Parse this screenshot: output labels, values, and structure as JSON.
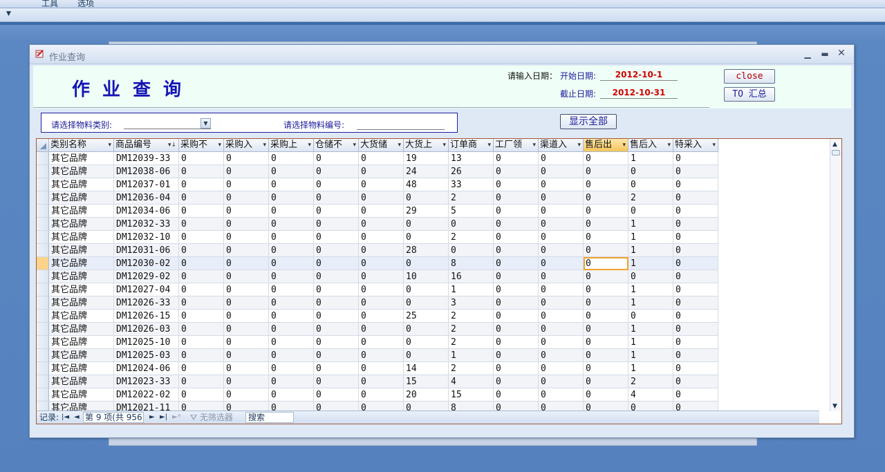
{
  "app": {
    "menu": [
      "工具",
      "选项"
    ]
  },
  "window": {
    "title": "作业查询"
  },
  "header": {
    "title": "作业查询",
    "date_prompt": "请输入日期：",
    "start_label": "开始日期:",
    "start_date": "2012-10-1",
    "end_label": "截止日期:",
    "end_date": "2012-10-31",
    "close_label": "close",
    "summary_label": "TO 汇总"
  },
  "filter": {
    "category_label": "请选择物料类别:",
    "category_value": "",
    "code_label": "请选择物料编号:",
    "code_value": "",
    "show_all_label": "显示全部"
  },
  "table": {
    "columns": [
      "类别名称",
      "商品编号",
      "采购不",
      "采购入",
      "采购上",
      "仓储不",
      "大货储",
      "大货上",
      "订单商",
      "工厂领",
      "渠道入",
      "售后出",
      "售后入",
      "特采入"
    ],
    "active_column_index": 11,
    "current_row_index": 8,
    "rows": [
      [
        "其它品牌",
        "DM12039-33",
        "0",
        "0",
        "0",
        "0",
        "0",
        "19",
        "13",
        "0",
        "0",
        "0",
        "1",
        "0"
      ],
      [
        "其它品牌",
        "DM12038-06",
        "0",
        "0",
        "0",
        "0",
        "0",
        "24",
        "26",
        "0",
        "0",
        "0",
        "0",
        "0"
      ],
      [
        "其它品牌",
        "DM12037-01",
        "0",
        "0",
        "0",
        "0",
        "0",
        "48",
        "33",
        "0",
        "0",
        "0",
        "0",
        "0"
      ],
      [
        "其它品牌",
        "DM12036-04",
        "0",
        "0",
        "0",
        "0",
        "0",
        "0",
        "2",
        "0",
        "0",
        "0",
        "2",
        "0"
      ],
      [
        "其它品牌",
        "DM12034-06",
        "0",
        "0",
        "0",
        "0",
        "0",
        "29",
        "5",
        "0",
        "0",
        "0",
        "0",
        "0"
      ],
      [
        "其它品牌",
        "DM12032-33",
        "0",
        "0",
        "0",
        "0",
        "0",
        "0",
        "0",
        "0",
        "0",
        "0",
        "1",
        "0"
      ],
      [
        "其它品牌",
        "DM12032-10",
        "0",
        "0",
        "0",
        "0",
        "0",
        "0",
        "2",
        "0",
        "0",
        "0",
        "1",
        "0"
      ],
      [
        "其它品牌",
        "DM12031-06",
        "0",
        "0",
        "0",
        "0",
        "0",
        "28",
        "0",
        "0",
        "0",
        "0",
        "1",
        "0"
      ],
      [
        "其它品牌",
        "DM12030-02",
        "0",
        "0",
        "0",
        "0",
        "0",
        "0",
        "8",
        "0",
        "0",
        "0",
        "1",
        "0"
      ],
      [
        "其它品牌",
        "DM12029-02",
        "0",
        "0",
        "0",
        "0",
        "0",
        "10",
        "16",
        "0",
        "0",
        "0",
        "0",
        "0"
      ],
      [
        "其它品牌",
        "DM12027-04",
        "0",
        "0",
        "0",
        "0",
        "0",
        "0",
        "1",
        "0",
        "0",
        "0",
        "1",
        "0"
      ],
      [
        "其它品牌",
        "DM12026-33",
        "0",
        "0",
        "0",
        "0",
        "0",
        "0",
        "3",
        "0",
        "0",
        "0",
        "1",
        "0"
      ],
      [
        "其它品牌",
        "DM12026-15",
        "0",
        "0",
        "0",
        "0",
        "0",
        "25",
        "2",
        "0",
        "0",
        "0",
        "0",
        "0"
      ],
      [
        "其它品牌",
        "DM12026-03",
        "0",
        "0",
        "0",
        "0",
        "0",
        "0",
        "2",
        "0",
        "0",
        "0",
        "1",
        "0"
      ],
      [
        "其它品牌",
        "DM12025-10",
        "0",
        "0",
        "0",
        "0",
        "0",
        "0",
        "2",
        "0",
        "0",
        "0",
        "1",
        "0"
      ],
      [
        "其它品牌",
        "DM12025-03",
        "0",
        "0",
        "0",
        "0",
        "0",
        "0",
        "1",
        "0",
        "0",
        "0",
        "1",
        "0"
      ],
      [
        "其它品牌",
        "DM12024-06",
        "0",
        "0",
        "0",
        "0",
        "0",
        "14",
        "2",
        "0",
        "0",
        "0",
        "1",
        "0"
      ],
      [
        "其它品牌",
        "DM12023-33",
        "0",
        "0",
        "0",
        "0",
        "0",
        "15",
        "4",
        "0",
        "0",
        "0",
        "2",
        "0"
      ],
      [
        "其它品牌",
        "DM12022-02",
        "0",
        "0",
        "0",
        "0",
        "0",
        "20",
        "15",
        "0",
        "0",
        "0",
        "4",
        "0"
      ],
      [
        "其它品牌",
        "DM12021-11",
        "0",
        "0",
        "0",
        "0",
        "0",
        "0",
        "8",
        "0",
        "0",
        "0",
        "0",
        "0"
      ]
    ]
  },
  "navigation": {
    "record_label": "记录:",
    "record_position": "第 9 项(共 956 项",
    "filter_label": "无筛选器",
    "search_label": "搜索"
  },
  "icons": {
    "window_icon": "form-icon",
    "minimize": "minimize-icon",
    "restore": "restore-icon",
    "close": "close-icon"
  }
}
